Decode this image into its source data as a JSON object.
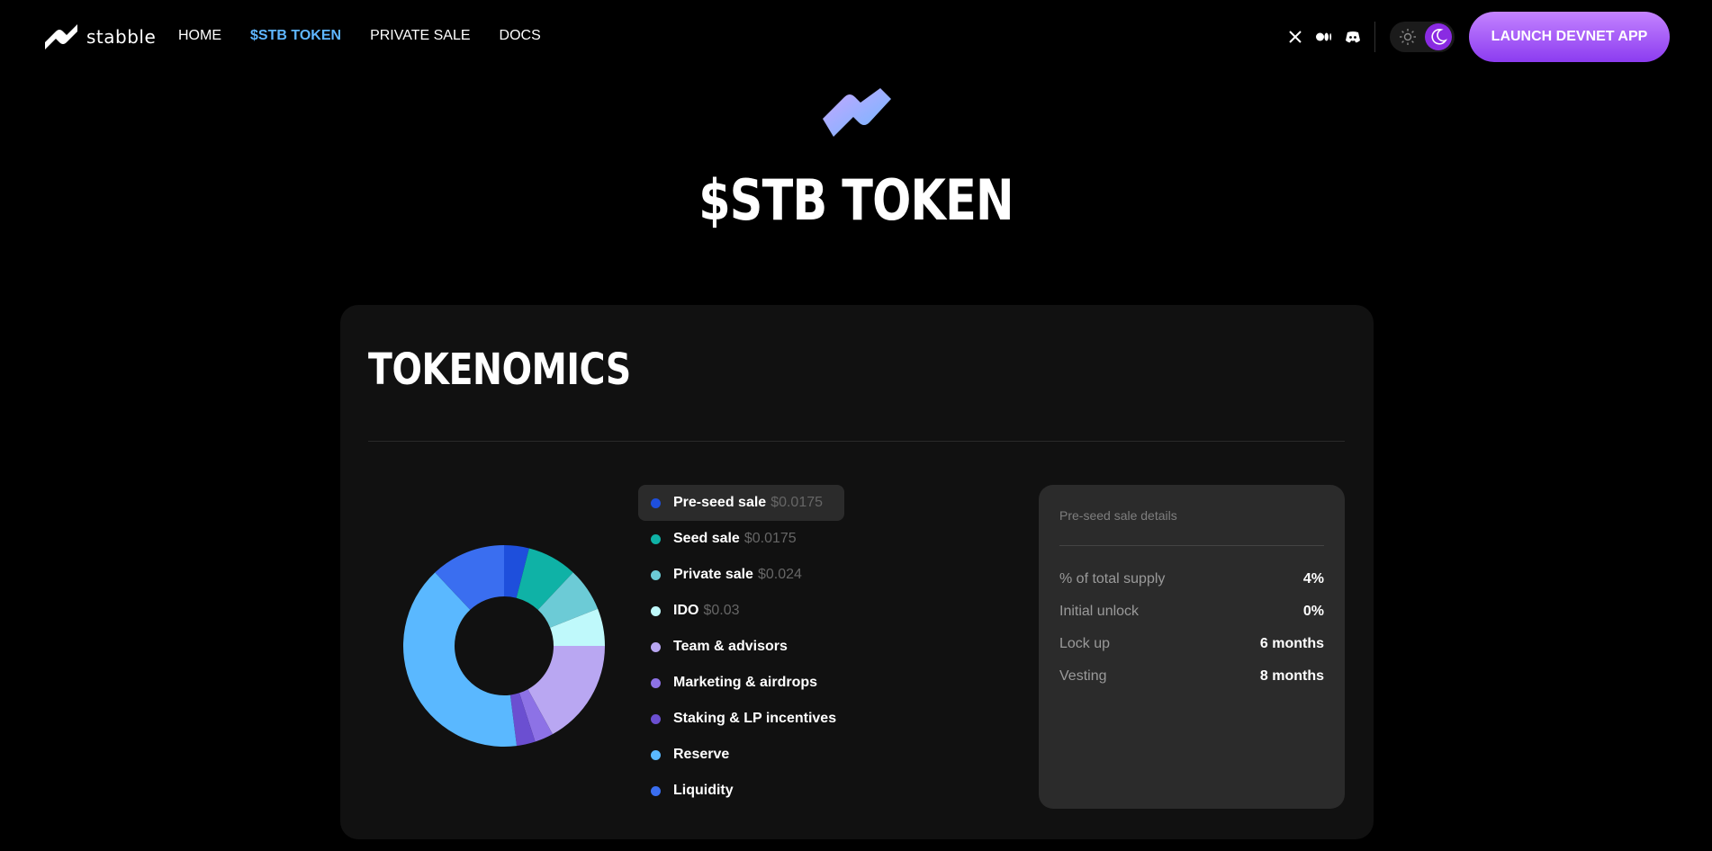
{
  "nav": {
    "logo_text": "stabble",
    "links": [
      {
        "label": "HOME",
        "active": false
      },
      {
        "label": "$STB TOKEN",
        "active": true
      },
      {
        "label": "PRIVATE SALE",
        "active": false
      },
      {
        "label": "DOCS",
        "active": false
      }
    ],
    "launch_label": "LAUNCH DEVNET APP"
  },
  "hero": {
    "title": "$STB TOKEN"
  },
  "tokenomics": {
    "title": "TOKENOMICS",
    "chart_data": {
      "type": "pie",
      "categories": [
        "Pre-seed sale",
        "Seed sale",
        "Private sale",
        "IDO",
        "Team & advisors",
        "Marketing & airdrops",
        "Staking & LP incentives",
        "Reserve",
        "Liquidity"
      ],
      "values": [
        4,
        8,
        7,
        6,
        17,
        3,
        3,
        40,
        12
      ],
      "colors": [
        "#1e4fdc",
        "#0fb2a6",
        "#6ccbd6",
        "#bff9fb",
        "#b9a7f2",
        "#8d72e6",
        "#6b4fd1",
        "#5ab8ff",
        "#3a6ef0"
      ]
    },
    "legend": [
      {
        "label": "Pre-seed sale",
        "price": "$0.0175"
      },
      {
        "label": "Seed sale",
        "price": "$0.0175"
      },
      {
        "label": "Private sale",
        "price": "$0.024"
      },
      {
        "label": "IDO",
        "price": "$0.03"
      },
      {
        "label": "Team & advisors",
        "price": ""
      },
      {
        "label": "Marketing & airdrops",
        "price": ""
      },
      {
        "label": "Staking & LP incentives",
        "price": ""
      },
      {
        "label": "Reserve",
        "price": ""
      },
      {
        "label": "Liquidity",
        "price": ""
      }
    ],
    "details": {
      "title": "Pre-seed sale details",
      "rows": [
        {
          "label": "% of total supply",
          "value": "4%"
        },
        {
          "label": "Initial unlock",
          "value": "0%"
        },
        {
          "label": "Lock up",
          "value": "6 months"
        },
        {
          "label": "Vesting",
          "value": "8 months"
        }
      ]
    }
  }
}
